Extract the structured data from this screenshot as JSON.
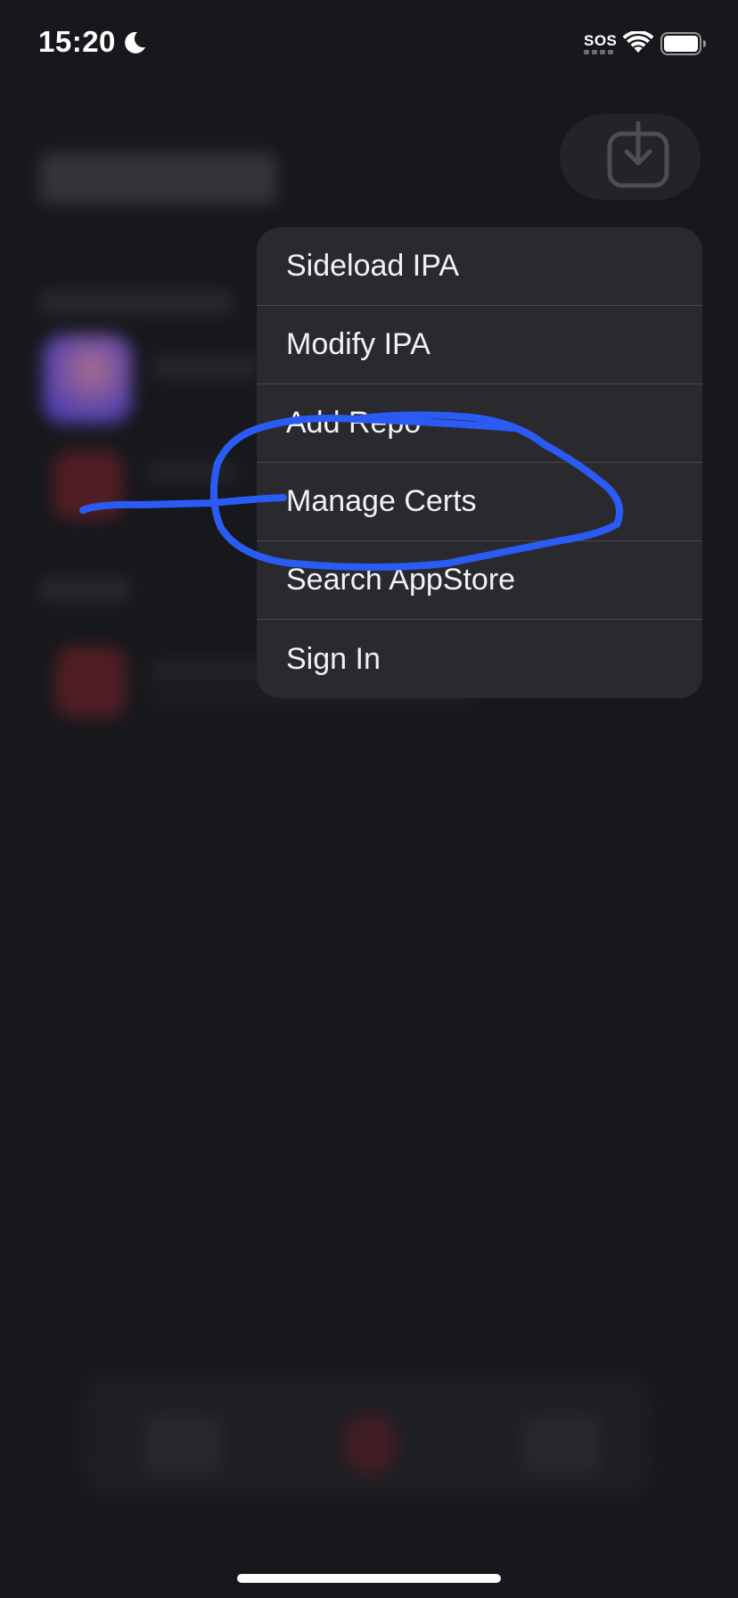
{
  "status_bar": {
    "time": "15:20",
    "cellular_label": "SOS",
    "moon_icon": "moon-icon",
    "wifi_icon": "wifi-icon",
    "battery_icon": "battery-icon"
  },
  "header": {
    "download_icon": "download-icon"
  },
  "context_menu": {
    "items": [
      {
        "label": "Sideload IPA"
      },
      {
        "label": "Modify IPA"
      },
      {
        "label": "Add Repo"
      },
      {
        "label": "Manage Certs"
      },
      {
        "label": "Search AppStore"
      },
      {
        "label": "Sign In"
      }
    ]
  },
  "annotation": {
    "color": "#2b5bf5",
    "highlighted_item": "Manage Certs"
  },
  "colors": {
    "background": "#17181c",
    "menu_background": "#2a2a2e",
    "menu_separator": "#48484d"
  }
}
